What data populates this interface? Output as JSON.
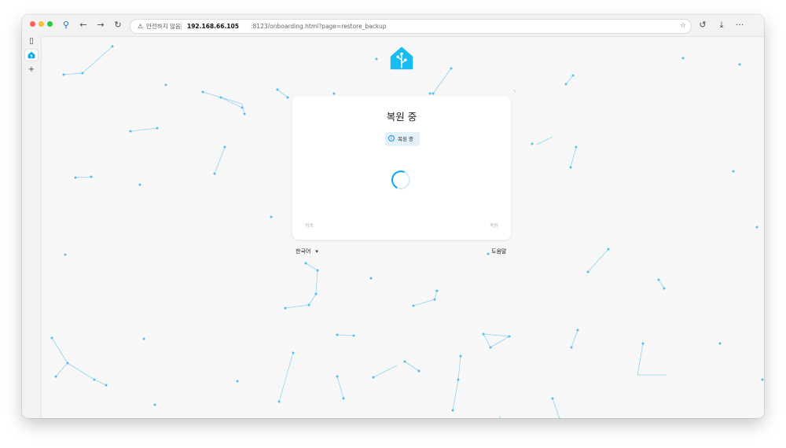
{
  "browser": {
    "url_warning": "⚠",
    "url_insecure_label": "안전하지 않음",
    "url_separator": "|",
    "url_host": "192.168.66.105",
    "url_rest": ":8123/onboarding.html?page=restore_backup",
    "icons": {
      "site_info": "location-pin-icon",
      "back": "back-arrow-icon",
      "forward": "forward-arrow-icon",
      "reload": "reload-icon",
      "bookmark": "star-icon",
      "extension": "extension-icon",
      "download": "download-icon",
      "more": "more-icon",
      "sidebar": "sidebar-panel-icon",
      "tab_app": "home-assistant-icon",
      "new_tab": "plus-icon"
    },
    "glyphs": {
      "site_info": "⚲",
      "back": "←",
      "forward": "→",
      "reload": "↻",
      "bookmark": "☆",
      "extension": "↺",
      "download": "⤓",
      "more": "···",
      "sidebar": "▯",
      "new_tab": "+"
    }
  },
  "card": {
    "title": "복원 중",
    "alert_icon": "i",
    "alert_text": "복원 중",
    "back_label": "뒤로",
    "restore_label": "복원"
  },
  "footer": {
    "language": "한국어",
    "language_caret": "▾",
    "help": "도움말"
  },
  "colors": {
    "accent": "#03a9f4",
    "page_background": "#f7f7f7",
    "card_background": "#ffffff",
    "alert_background": "#e3f1fb"
  }
}
